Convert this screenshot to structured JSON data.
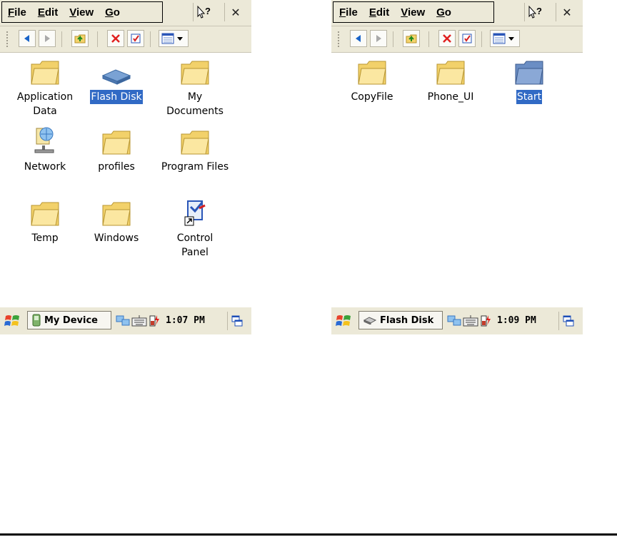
{
  "left": {
    "menu": [
      "File",
      "Edit",
      "View",
      "Go"
    ],
    "icons": [
      {
        "name": "folder-icon",
        "label1": "Application",
        "label2": "Data",
        "selected": false
      },
      {
        "name": "flash-disk-icon",
        "label1": "Flash Disk",
        "label2": "",
        "selected": true
      },
      {
        "name": "folder-icon",
        "label1": "My",
        "label2": "Documents",
        "selected": false
      },
      {
        "name": "network-icon",
        "label1": "Network",
        "label2": "",
        "selected": false
      },
      {
        "name": "folder-icon",
        "label1": "profiles",
        "label2": "",
        "selected": false
      },
      {
        "name": "folder-icon",
        "label1": "Program Files",
        "label2": "",
        "selected": false
      },
      {
        "name": "folder-icon",
        "label1": "Temp",
        "label2": "",
        "selected": false
      },
      {
        "name": "folder-icon",
        "label1": "Windows",
        "label2": "",
        "selected": false
      },
      {
        "name": "control-panel-icon",
        "label1": "Control",
        "label2": "Panel",
        "selected": false
      }
    ],
    "taskbar_label": "My Device",
    "clock": "1:07 PM"
  },
  "right": {
    "menu": [
      "File",
      "Edit",
      "View",
      "Go"
    ],
    "icons": [
      {
        "name": "folder-icon",
        "label1": "CopyFile",
        "selected": false
      },
      {
        "name": "folder-icon",
        "label1": "Phone_UI",
        "selected": false
      },
      {
        "name": "folder-shortcut-icon",
        "label1": "Start",
        "selected": true
      }
    ],
    "taskbar_label": "Flash Disk",
    "clock": "1:09 PM"
  }
}
